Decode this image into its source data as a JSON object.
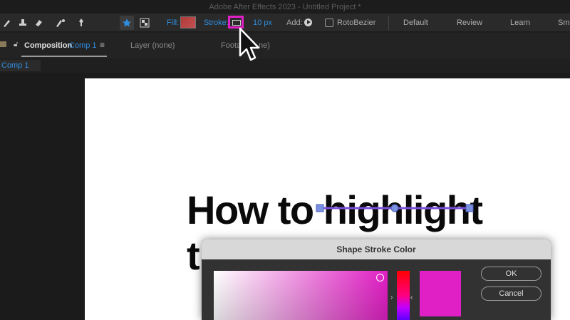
{
  "window": {
    "title": "Adobe After Effects 2023 - Untitled Project *"
  },
  "toolbar": {
    "fill_label": "Fill:",
    "stroke_label": "Stroke:",
    "stroke_width": "10 px",
    "add_label": "Add:",
    "rotobezier_label": "RotoBezier",
    "stroke_color": "#e01fc4",
    "fill_color": "#c04545",
    "workspaces": [
      "Default",
      "Review",
      "Learn",
      "Sma"
    ]
  },
  "panels": {
    "composition_tab_prefix": "Composition",
    "composition_tab_name": "Comp 1",
    "layer_tab": "Layer (none)",
    "footage_tab_visible": "Foota",
    "footage_tab_tail": "ne)",
    "comp_chip": "Comp 1"
  },
  "canvas": {
    "headline_line1_a": "How to ",
    "headline_line1_b": "highlight",
    "headline_line2": "te"
  },
  "dialog": {
    "title": "Shape Stroke Color",
    "ok_label": "OK",
    "cancel_label": "Cancel",
    "selected_color": "#e01fc4"
  }
}
